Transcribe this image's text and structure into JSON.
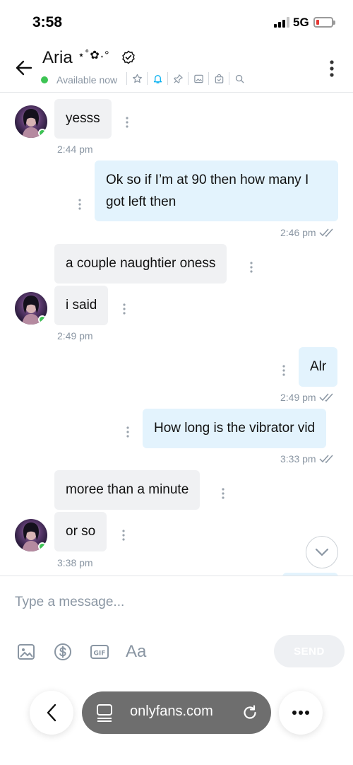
{
  "status_bar": {
    "time": "3:58",
    "network": "5G"
  },
  "header": {
    "name": "Aria",
    "name_decoration": "⋆˚✿˖°",
    "presence": "Available now"
  },
  "messages": [
    {
      "id": "m1",
      "side": "in",
      "text": "yesss"
    },
    {
      "id": "t1",
      "stamp": "2:44 pm"
    },
    {
      "id": "m2",
      "side": "out",
      "text": "Ok so if I’m at 90 then how many I got left then"
    },
    {
      "id": "t2",
      "stamp": "2:46 pm"
    },
    {
      "id": "m3",
      "side": "in",
      "text": "a couple naughtier oness"
    },
    {
      "id": "m4",
      "side": "in",
      "text": "i said"
    },
    {
      "id": "t3",
      "stamp": "2:49 pm"
    },
    {
      "id": "m5",
      "side": "out",
      "text": "Alr"
    },
    {
      "id": "t4",
      "stamp": "2:49 pm"
    },
    {
      "id": "m6",
      "side": "out",
      "text": "How long is the vibrator vid"
    },
    {
      "id": "t5",
      "stamp": "3:33 pm"
    },
    {
      "id": "m7",
      "side": "in",
      "text": "moree than a minute"
    },
    {
      "id": "m8",
      "side": "in",
      "text": "or so"
    },
    {
      "id": "t6",
      "stamp": "3:38 pm"
    }
  ],
  "composer": {
    "placeholder": "Type a message...",
    "font_tool": "Aa",
    "send_label": "SEND"
  },
  "browser": {
    "url": "onlyfans.com"
  },
  "colors": {
    "accent": "#00aff0",
    "online": "#3dc454",
    "incoming_bubble": "#f0f1f3",
    "outgoing_bubble": "#e3f3fd",
    "muted": "#8a96a3"
  },
  "icons": [
    "back-arrow-icon",
    "verified-icon",
    "star-icon",
    "bell-icon",
    "pin-icon",
    "image-icon",
    "bag-icon",
    "search-icon",
    "more-vertical-icon",
    "read-checkmarks-icon",
    "chevron-down-icon",
    "dollar-icon",
    "gif-icon",
    "reload-icon",
    "tabs-icon",
    "more-horizontal-icon"
  ]
}
